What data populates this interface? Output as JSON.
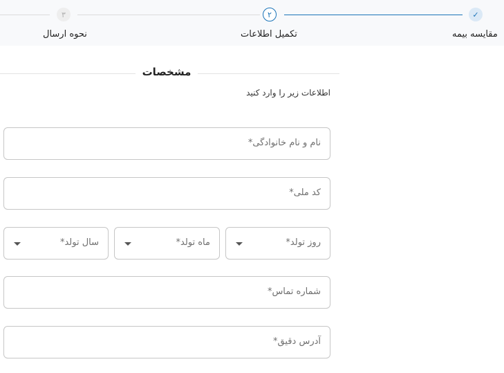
{
  "stepper": {
    "steps": [
      {
        "label": "مقایسه بیمه",
        "marker": "✓",
        "state": "done"
      },
      {
        "label": "تکمیل اطلاعات",
        "marker": "۲",
        "state": "current"
      },
      {
        "label": "نحوه ارسال",
        "marker": "۳",
        "state": "pending"
      }
    ]
  },
  "section": {
    "title": "مشخصات",
    "subtitle": "اطلاعات زیر را وارد کنید"
  },
  "form": {
    "full_name": {
      "placeholder": "نام و نام خانوادگی*"
    },
    "national_code": {
      "placeholder": "کد ملی*"
    },
    "birth_day": {
      "placeholder": "روز تولد*"
    },
    "birth_month": {
      "placeholder": "ماه تولد*"
    },
    "birth_year": {
      "placeholder": "سال تولد*"
    },
    "phone": {
      "placeholder": "شماره تماس*"
    },
    "address": {
      "placeholder": "آدرس دقیق*"
    }
  },
  "colors": {
    "accent": "#1a73b8",
    "border": "#c6c6c6"
  }
}
